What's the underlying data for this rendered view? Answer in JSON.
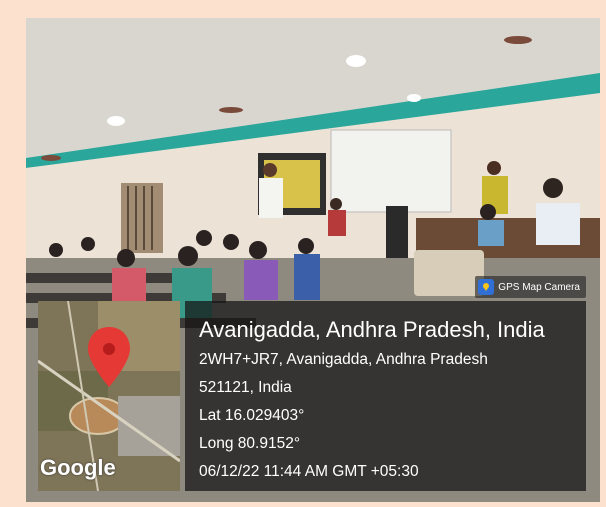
{
  "badge": {
    "icon": "gps-map-camera-app-icon",
    "label": "GPS Map Camera"
  },
  "location": {
    "title": "Avanigadda, Andhra Pradesh, India",
    "address_line1": "2WH7+JR7, Avanigadda, Andhra Pradesh",
    "address_line2": "521121, India",
    "latitude": "Lat 16.029403°",
    "longitude": "Long 80.9152°",
    "timestamp": "06/12/22 11:44 AM GMT +05:30"
  },
  "map": {
    "attribution": "Google",
    "pin_color": "#e53935"
  }
}
